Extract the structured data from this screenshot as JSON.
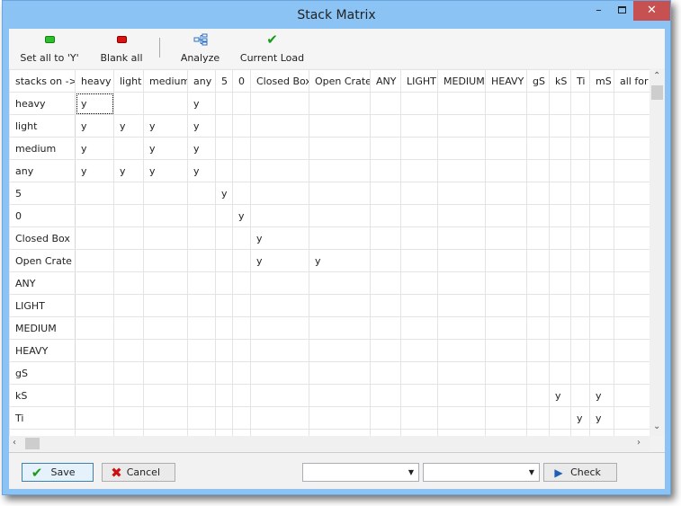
{
  "window": {
    "title": "Stack Matrix",
    "minimize_icon": "minimize-icon",
    "maximize_icon": "maximize-icon",
    "close_icon": "close-icon"
  },
  "toolbar": {
    "set_all": "Set all to 'Y'",
    "blank_all": "Blank all",
    "analyze": "Analyze",
    "current_load": "Current Load"
  },
  "grid": {
    "corner": "stacks on ->",
    "columns": [
      "heavy",
      "light",
      "medium",
      "any",
      "5",
      "0",
      "Closed Box",
      "Open Crate",
      "ANY",
      "LIGHT",
      "MEDIUM",
      "HEAVY",
      "gS",
      "kS",
      "Ti",
      "mS",
      "all for r"
    ],
    "rows": [
      {
        "label": "heavy",
        "cells": [
          "y",
          "",
          "",
          "y",
          "",
          "",
          "",
          "",
          "",
          "",
          "",
          "",
          "",
          "",
          "",
          "",
          ""
        ]
      },
      {
        "label": "light",
        "cells": [
          "y",
          "y",
          "y",
          "y",
          "",
          "",
          "",
          "",
          "",
          "",
          "",
          "",
          "",
          "",
          "",
          "",
          ""
        ]
      },
      {
        "label": "medium",
        "cells": [
          "y",
          "",
          "y",
          "y",
          "",
          "",
          "",
          "",
          "",
          "",
          "",
          "",
          "",
          "",
          "",
          "",
          ""
        ]
      },
      {
        "label": "any",
        "cells": [
          "y",
          "y",
          "y",
          "y",
          "",
          "",
          "",
          "",
          "",
          "",
          "",
          "",
          "",
          "",
          "",
          "",
          ""
        ]
      },
      {
        "label": "5",
        "cells": [
          "",
          "",
          "",
          "",
          "y",
          "",
          "",
          "",
          "",
          "",
          "",
          "",
          "",
          "",
          "",
          "",
          ""
        ]
      },
      {
        "label": "0",
        "cells": [
          "",
          "",
          "",
          "",
          "",
          "y",
          "",
          "",
          "",
          "",
          "",
          "",
          "",
          "",
          "",
          "",
          ""
        ]
      },
      {
        "label": "Closed Box",
        "cells": [
          "",
          "",
          "",
          "",
          "",
          "",
          "y",
          "",
          "",
          "",
          "",
          "",
          "",
          "",
          "",
          "",
          ""
        ]
      },
      {
        "label": "Open Crate",
        "cells": [
          "",
          "",
          "",
          "",
          "",
          "",
          "y",
          "y",
          "",
          "",
          "",
          "",
          "",
          "",
          "",
          "",
          ""
        ]
      },
      {
        "label": "ANY",
        "cells": [
          "",
          "",
          "",
          "",
          "",
          "",
          "",
          "",
          "",
          "",
          "",
          "",
          "",
          "",
          "",
          "",
          ""
        ]
      },
      {
        "label": "LIGHT",
        "cells": [
          "",
          "",
          "",
          "",
          "",
          "",
          "",
          "",
          "",
          "",
          "",
          "",
          "",
          "",
          "",
          "",
          ""
        ]
      },
      {
        "label": "MEDIUM",
        "cells": [
          "",
          "",
          "",
          "",
          "",
          "",
          "",
          "",
          "",
          "",
          "",
          "",
          "",
          "",
          "",
          "",
          ""
        ]
      },
      {
        "label": "HEAVY",
        "cells": [
          "",
          "",
          "",
          "",
          "",
          "",
          "",
          "",
          "",
          "",
          "",
          "",
          "",
          "",
          "",
          "",
          ""
        ]
      },
      {
        "label": "gS",
        "cells": [
          "",
          "",
          "",
          "",
          "",
          "",
          "",
          "",
          "",
          "",
          "",
          "",
          "",
          "",
          "",
          "",
          ""
        ]
      },
      {
        "label": "kS",
        "cells": [
          "",
          "",
          "",
          "",
          "",
          "",
          "",
          "",
          "",
          "",
          "",
          "",
          "",
          "y",
          "",
          "y",
          ""
        ]
      },
      {
        "label": "Ti",
        "cells": [
          "",
          "",
          "",
          "",
          "",
          "",
          "",
          "",
          "",
          "",
          "",
          "",
          "",
          "",
          "y",
          "y",
          ""
        ]
      }
    ]
  },
  "footer": {
    "save": "Save",
    "cancel": "Cancel",
    "dropdown1": "",
    "dropdown2": "",
    "check": "Check"
  },
  "colors": {
    "title_bar": "#8cc3f5",
    "close_button": "#c75050",
    "green": "#22a422",
    "red": "#cc1111"
  }
}
